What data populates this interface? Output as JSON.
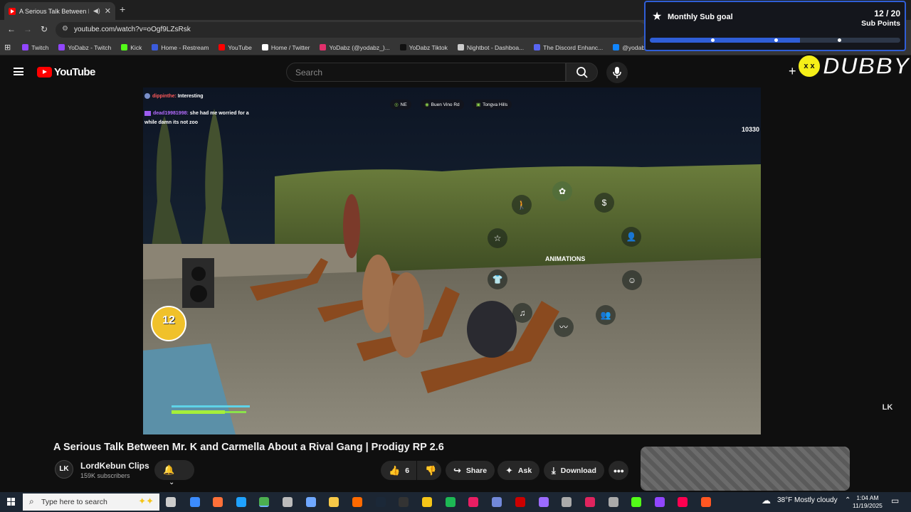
{
  "browser": {
    "tab_title": "A Serious Talk Between Mr.",
    "new_tab_symbol": "+",
    "url": "youtube.com/watch?v=oOgf9LZsRsk",
    "bookmarks": [
      {
        "label": "Twitch",
        "color": "#9146ff"
      },
      {
        "label": "YoDabz - Twitch",
        "color": "#9146ff"
      },
      {
        "label": "Kick",
        "color": "#53fc18"
      },
      {
        "label": "Home - Restream",
        "color": "#3b5bdb"
      },
      {
        "label": "YouTube",
        "color": "#ff0000"
      },
      {
        "label": "Home / Twitter",
        "color": "#ffffff"
      },
      {
        "label": "YoDabz (@yodabz_)...",
        "color": "#e1306c"
      },
      {
        "label": "YoDabz Tiktok",
        "color": "#111111"
      },
      {
        "label": "Nightbot - Dashboa...",
        "color": "#cccccc"
      },
      {
        "label": "The Discord Enhanc...",
        "color": "#5865f2"
      },
      {
        "label": "@yodabz.bsky.socia...",
        "color": "#1185fe"
      }
    ]
  },
  "sub_goal": {
    "title": "Monthly Sub goal",
    "count": "12 / 20",
    "unit": "Sub Points",
    "progress": 0.6,
    "accent": "#2f5ed7"
  },
  "logo": {
    "text": "DUBBY"
  },
  "youtube": {
    "brand": "YouTube",
    "search_placeholder": "Search"
  },
  "video": {
    "chat": [
      {
        "user": "dippinthe:",
        "user_color": "#ff5a5a",
        "message": "Interesting"
      },
      {
        "user": "dead19981998:",
        "user_color": "#b46bff",
        "message": "she had me worried for a while damn its not zoo"
      }
    ],
    "location_chips": [
      "NE",
      "Buen Vino Rd",
      "Tongva Hills"
    ],
    "score": "10330",
    "radial_menu_label": "ANIMATIONS",
    "level_badge": "12",
    "watermark": "LK"
  },
  "meta": {
    "title": "A Serious Talk Between Mr. K and Carmella About a Rival Gang | Prodigy RP 2.6",
    "channel_name": "LordKebun Clips",
    "channel_subs": "159K subscribers",
    "likes": "6",
    "share_label": "Share",
    "ask_label": "Ask",
    "download_label": "Download"
  },
  "taskbar": {
    "search_placeholder": "Type here to search",
    "weather": "38°F  Mostly cloudy",
    "time": "1:04 AM",
    "date": "11/19/2025"
  }
}
